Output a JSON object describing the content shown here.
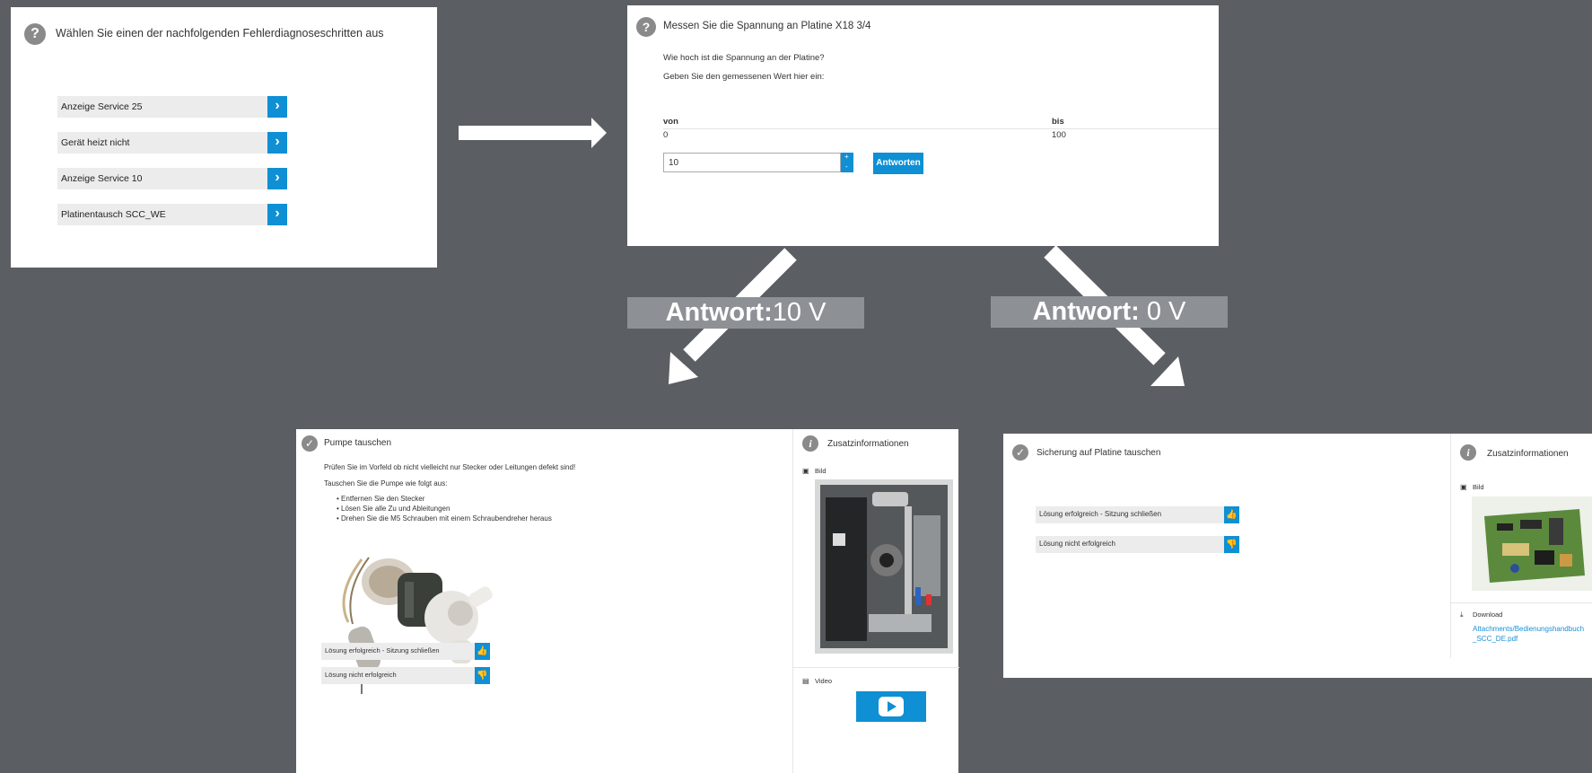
{
  "diagnose_panel": {
    "title": "Wählen Sie einen der nachfolgenden Fehlerdiagnoseschritten aus",
    "items": [
      {
        "label": "Anzeige Service 25"
      },
      {
        "label": "Gerät heizt nicht"
      },
      {
        "label": "Anzeige Service 10"
      },
      {
        "label": "Platinentausch SCC_WE"
      }
    ]
  },
  "measure_panel": {
    "title": "Messen Sie die Spannung an Platine X18 3/4",
    "question": "Wie hoch ist die Spannung an der Platine?",
    "instruction": "Geben Sie den gemessenen Wert hier ein:",
    "range_from_label": "von",
    "range_from_value": "0",
    "range_to_label": "bis",
    "range_to_value": "100",
    "input_value": "10",
    "submit_label": "Antworten"
  },
  "answer_labels": {
    "left": {
      "prefix": "Antwort:",
      "value": "10 V"
    },
    "right": {
      "prefix": "Antwort:",
      "value": " 0 V"
    }
  },
  "pump_panel": {
    "title": "Pumpe tauschen",
    "intro": "Prüfen Sie im Vorfeld ob nicht vielleicht nur Stecker oder Leitungen defekt sind!",
    "steps_heading": "Tauschen Sie die Pumpe wie folgt aus:",
    "steps": [
      "Entfernen Sie den Stecker",
      "Lösen Sie alle Zu und Ableitungen",
      "Drehen Sie die M5 Schrauben mit einem Schraubendreher heraus"
    ],
    "success_label": "Lösung erfolgreich - Sitzung schließen",
    "fail_label": "Lösung nicht erfolgreich",
    "sidebar": {
      "title": "Zusatzinformationen",
      "image_label": "Bild",
      "video_label": "Video"
    }
  },
  "fuse_panel": {
    "title": "Sicherung auf Platine tauschen",
    "success_label": "Lösung erfolgreich - Sitzung schließen",
    "fail_label": "Lösung nicht erfolgreich",
    "sidebar": {
      "title": "Zusatzinformationen",
      "image_label": "Bild",
      "download_label": "Download",
      "download_link_1": "Attachments/Bedienungshandbuch",
      "download_link_2": "_SCC_DE.pdf"
    }
  },
  "colors": {
    "background": "#5b5f63",
    "accent": "#0f8fd4",
    "label_box": "#8d9196"
  }
}
